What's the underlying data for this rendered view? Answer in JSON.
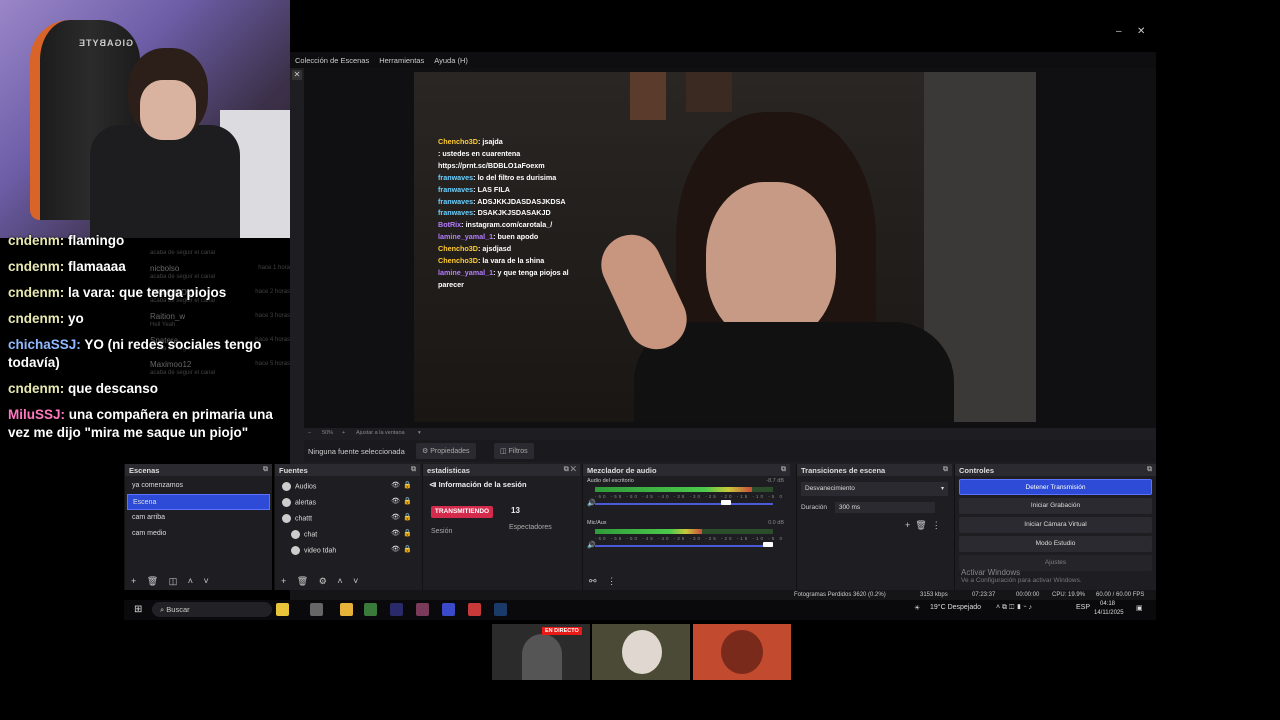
{
  "webcam": {
    "chair_brand": "GIGABYTE"
  },
  "chat_overlay": [
    {
      "user": "cndenm",
      "text": "flamingo",
      "color": "#e8e8b0"
    },
    {
      "user": "cndenm",
      "text": "flamaaaa",
      "color": "#e8e8b0"
    },
    {
      "user": "cndenm",
      "text": "la vara: que tenga piojos",
      "color": "#e8e8b0"
    },
    {
      "user": "cndenm",
      "text": "yo",
      "color": "#e8e8b0"
    },
    {
      "user": "chichaSSJ",
      "text": "YO (ni redes sociales tengo todavía)",
      "color": "#8fb8ff"
    },
    {
      "user": "cndenm",
      "text": "que descanso",
      "color": "#e8e8b0"
    },
    {
      "user": "MiluSSJ",
      "text": "una compañera en primaria una vez me dijo \"mira me saque un piojo\"",
      "color": "#ff78c0"
    }
  ],
  "activity_feed": [
    {
      "name": "",
      "sub": "acaba de seguir el canal",
      "time": ""
    },
    {
      "name": "nicbolso",
      "sub": "acaba de seguir el canal",
      "time": "hace 1 hora"
    },
    {
      "name": "JIMMYQDIS",
      "sub": "acaba de seguir el canal",
      "time": "hace 2 horas"
    },
    {
      "name": "Raition_w",
      "sub": "Hell Yeah",
      "time": "hace 3 horas"
    },
    {
      "name": "Spatera",
      "sub": "acaba de seguir el canal",
      "time": "hace 4 horas"
    },
    {
      "name": "Maximoo12",
      "sub": "acaba de seguir el canal",
      "time": "hace 5 horas"
    }
  ],
  "obs": {
    "menu": [
      "Colección de Escenas",
      "Herramientas",
      "Ayuda (H)"
    ],
    "window_controls": {
      "minimize": "–",
      "maximize": "❐",
      "close": "✕"
    },
    "preview_chat": [
      {
        "user": "Chencho3D",
        "text": "jsajda",
        "uc": "cy"
      },
      {
        "user": "",
        "text": "ustedes en cuarentena https://prnt.sc/BDBLO1aFoexm",
        "uc": "cr"
      },
      {
        "user": "franwaves",
        "text": "lo del filtro es durisima",
        "uc": "cb"
      },
      {
        "user": "franwaves",
        "text": "LAS FILA",
        "uc": "cb"
      },
      {
        "user": "franwaves",
        "text": "ADSJKKJDASDASJKDSA",
        "uc": "cb"
      },
      {
        "user": "franwaves",
        "text": "DSAKJKJSDASAKJD",
        "uc": "cb"
      },
      {
        "user": "BotRix",
        "text": "instagram.com/carotala_/",
        "uc": "cu"
      },
      {
        "user": "lamine_yamal_1",
        "text": "buen apodo",
        "uc": "cu"
      },
      {
        "user": "Chencho3D",
        "text": "ajsdjasd",
        "uc": "cy"
      },
      {
        "user": "Chencho3D",
        "text": "la vara de la shina",
        "uc": "cy"
      },
      {
        "user": "lamine_yamal_1",
        "text": "y que tenga piojos al parecer",
        "uc": "cu"
      }
    ],
    "preview_toolbar": {
      "zoom": "50%",
      "fit": "Ajustar a la ventana"
    },
    "source_bar": {
      "label": "Ninguna fuente seleccionada",
      "props": "Propiedades",
      "filters": "Filtros"
    },
    "scenes": {
      "title": "Escenas",
      "items": [
        "ya comenzamos",
        "Escena",
        "cam arriba",
        "cam medio"
      ],
      "active_index": 1
    },
    "sources": {
      "title": "Fuentes",
      "items": [
        "Audios",
        "alertas",
        "chattt",
        "chat",
        "video tdah"
      ]
    },
    "stats": {
      "title": "estadisticas",
      "section": "Información de la sesión",
      "badge": "TRANSMITIENDO",
      "viewers": "13",
      "viewers_label": "Espectadores",
      "session_label": "Sesión"
    },
    "mixer": {
      "title": "Mezclador de audio",
      "channels": [
        {
          "name": "Audio del escritorio",
          "db": "-8.7 dB",
          "level": 0.88,
          "volume": 0.75
        },
        {
          "name": "Mic/Aux",
          "db": "0.0 dB",
          "level": 0.6,
          "volume": 1.0
        }
      ],
      "scale": "-60 -55 -50 -45 -40 -35 -30 -25 -20 -15 -10 -5 0"
    },
    "transitions": {
      "title": "Transiciones de escena",
      "selected": "Desvanecimiento",
      "duration_label": "Duración",
      "duration": "300 ms"
    },
    "controls": {
      "title": "Controles",
      "buttons": [
        "Detener Transmisión",
        "Iniciar Grabación",
        "Iniciar Cámara Virtual",
        "Modo Estudio",
        "Ajustes"
      ],
      "activate_windows": "Activar Windows",
      "activate_sub": "Ve a Configuración para activar Windows."
    },
    "status": {
      "dropped": "Fotogramas Perdidos 3620 (0.2%)",
      "bitrate": "3153 kbps",
      "live_time": "07:23:37",
      "rec_time": "00:00:00",
      "cpu": "CPU: 19.9%",
      "fps": "60.00 / 60.00 FPS"
    }
  },
  "taskbar": {
    "search": "Buscar",
    "weather": "19°C  Despejado",
    "lang": "ESP",
    "time": "04:18",
    "date": "14/11/2025"
  },
  "tiles": {
    "live_label": "EN DIRECTO"
  }
}
